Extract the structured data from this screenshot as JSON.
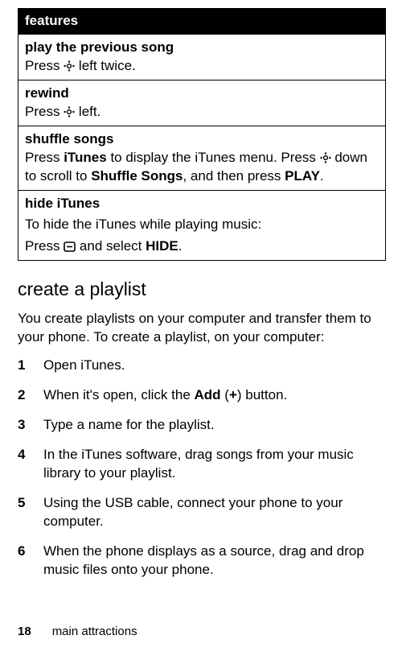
{
  "table": {
    "header": "features",
    "rows": [
      {
        "title": "play the previous song",
        "body_pre": "Press ",
        "body_post": " left twice."
      },
      {
        "title": "rewind",
        "body_pre": "Press ",
        "body_post": " left."
      },
      {
        "title": "shuffle songs",
        "body_pre": "Press ",
        "menu1": "iTunes",
        "body_mid1": " to display the iTunes menu. Press ",
        "body_mid2": " down to scroll to ",
        "menu2": "Shuffle Songs",
        "body_mid3": ", and then press ",
        "menu3": "PLAY",
        "body_post": "."
      },
      {
        "title": "hide iTunes",
        "intro": "To hide the iTunes while playing music:",
        "body_pre": "Press ",
        "body_mid": "  and select ",
        "menu1": "HIDE",
        "body_post": "."
      }
    ]
  },
  "section_title": "create a playlist",
  "intro_para": "You create playlists on your computer and transfer them to your phone. To create a playlist, on your computer:",
  "steps": [
    {
      "text": "Open iTunes."
    },
    {
      "pre": "When it's open, click the ",
      "menu": "Add",
      "paren_pre": " (",
      "plus": "+",
      "paren_post": ") button."
    },
    {
      "text": "Type a name for the playlist."
    },
    {
      "text": " In the iTunes software, drag songs from your music library to your playlist."
    },
    {
      "text": "Using the USB cable, connect your phone to your computer."
    },
    {
      "text": "When the phone displays as a source, drag and drop music files onto your phone."
    }
  ],
  "footer": {
    "page": "18",
    "section": "main attractions"
  }
}
